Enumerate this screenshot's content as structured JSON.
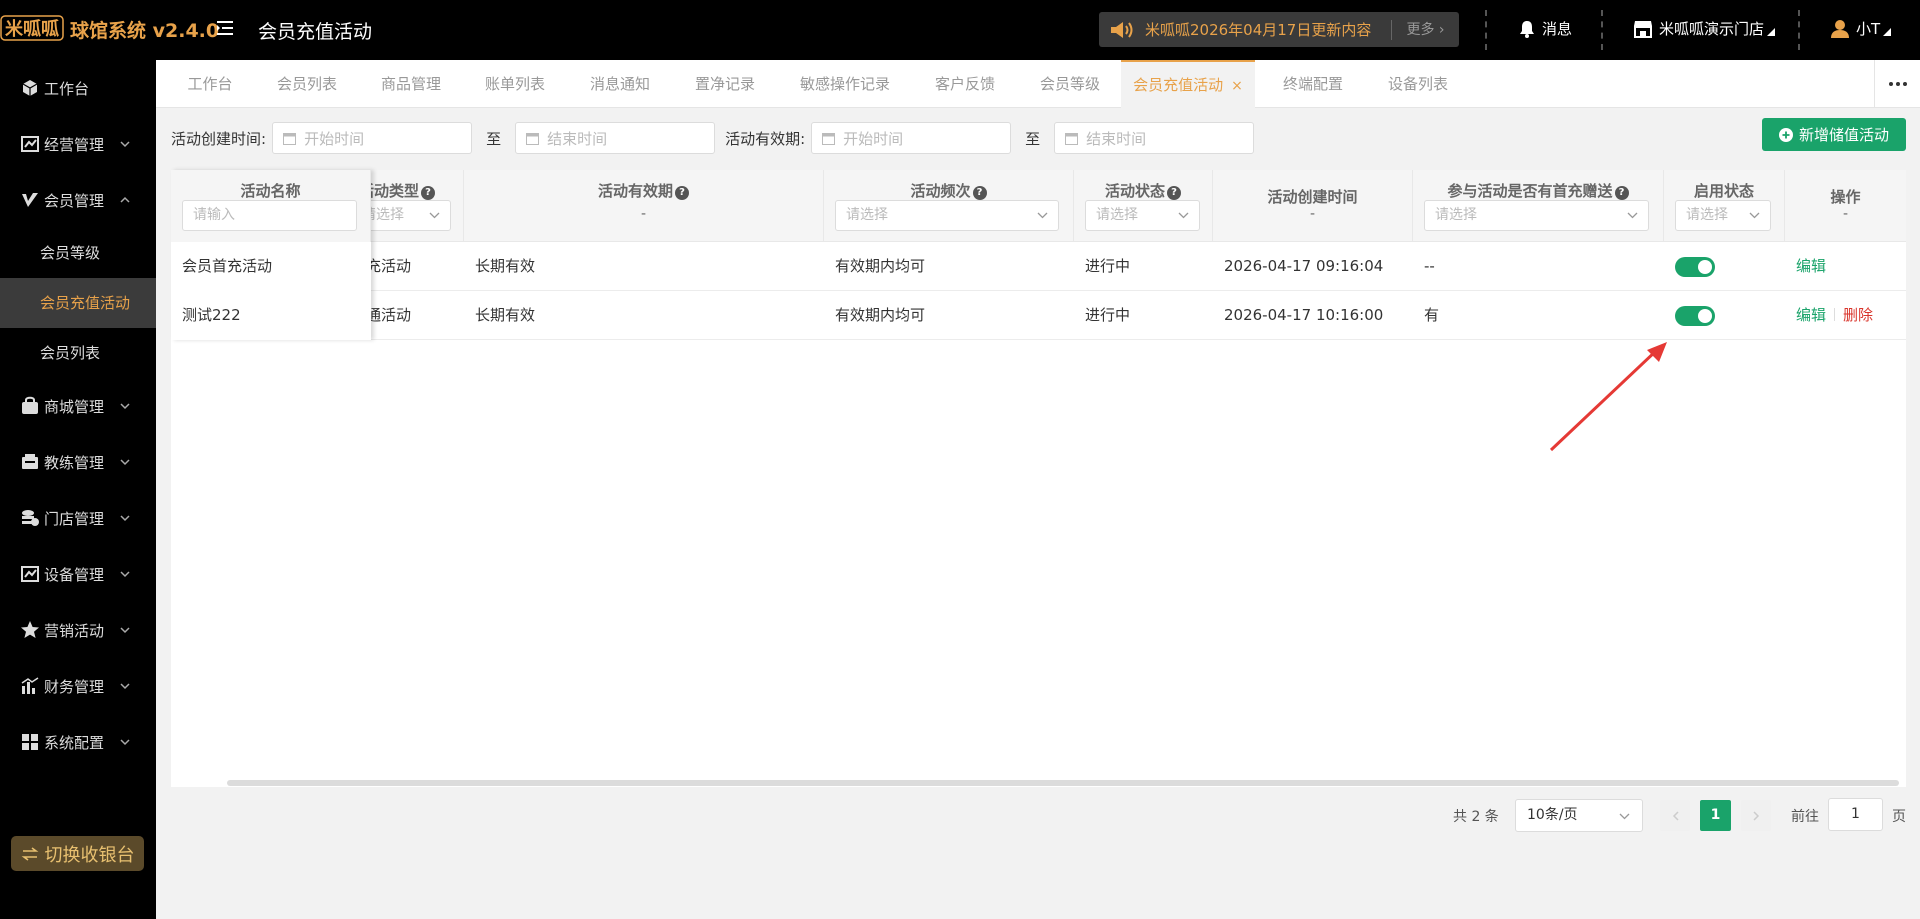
{
  "header": {
    "logo_text": "米呱呱",
    "app_name": "球馆系统 v2.4.0",
    "page_title": "会员充值活动",
    "notice_text": "米呱呱2026年04月17日更新内容",
    "notice_more": "更多",
    "messages_label": "消息",
    "store_label": "米呱呱演示门店",
    "user_label": "小T"
  },
  "sidebar": {
    "items": [
      {
        "label": "工作台",
        "icon": "cube-icon"
      },
      {
        "label": "经营管理",
        "icon": "chart-board-icon"
      },
      {
        "label": "会员管理",
        "icon": "vip-v-icon"
      },
      {
        "label": "商城管理",
        "icon": "shop-bag-icon"
      },
      {
        "label": "教练管理",
        "icon": "coach-icon"
      },
      {
        "label": "门店管理",
        "icon": "store-stack-icon"
      },
      {
        "label": "设备管理",
        "icon": "device-icon"
      },
      {
        "label": "营销活动",
        "icon": "star-icon"
      },
      {
        "label": "财务管理",
        "icon": "finance-bar-icon"
      },
      {
        "label": "系统配置",
        "icon": "grid-icon"
      }
    ],
    "sub_items": [
      "会员等级",
      "会员充值活动",
      "会员列表"
    ],
    "switch_button": "切换收银台"
  },
  "tabs": [
    "工作台",
    "会员列表",
    "商品管理",
    "账单列表",
    "消息通知",
    "置净记录",
    "敏感操作记录",
    "客户反馈",
    "会员等级",
    "会员充值活动",
    "终端配置",
    "设备列表"
  ],
  "active_tab_close": "×",
  "filters": {
    "create_time_label": "活动创建时间:",
    "valid_label": "活动有效期:",
    "start_placeholder": "开始时间",
    "end_placeholder": "结束时间",
    "to": "至",
    "add_button": "新增储值活动"
  },
  "table": {
    "headers": {
      "name": "活动名称",
      "type": "活动类型",
      "validity": "活动有效期",
      "frequency": "活动频次",
      "status": "活动状态",
      "created": "活动创建时间",
      "first_gift": "参与活动是否有首充赠送",
      "enabled": "启用状态",
      "ops": "操作"
    },
    "name_placeholder": "请输入",
    "select_placeholder": "请选择",
    "dash": "-",
    "rows": [
      {
        "name": "会员首充活动",
        "type": "首充活动",
        "validity": "长期有效",
        "frequency": "有效期内均可",
        "status": "进行中",
        "created": "2026-04-17 09:16:04",
        "first_gift": "--",
        "enabled": true,
        "edit": "编辑",
        "delete": ""
      },
      {
        "name": "测试222",
        "type": "普通活动",
        "validity": "长期有效",
        "frequency": "有效期内均可",
        "status": "进行中",
        "created": "2026-04-17 10:16:00",
        "first_gift": "有",
        "enabled": true,
        "edit": "编辑",
        "delete": "删除"
      }
    ]
  },
  "pagination": {
    "total": "共 2 条",
    "page_size": "10条/页",
    "current_page": "1",
    "goto_label": "前往",
    "goto_value": "1",
    "page_unit": "页"
  },
  "colors": {
    "accent": "#1aa36a",
    "brand": "#e8a24a",
    "danger": "#d9342b",
    "arrow": "#e53935"
  }
}
